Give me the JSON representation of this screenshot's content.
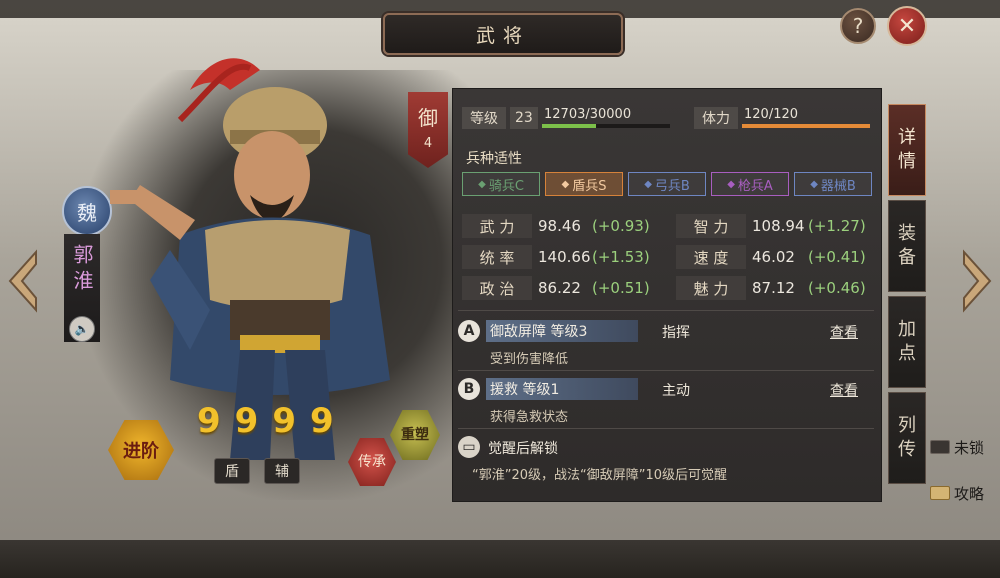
{
  "window": {
    "title": "武将"
  },
  "controls": {
    "help": "?",
    "close": "✕"
  },
  "general": {
    "faction": "魏",
    "name": "郭淮",
    "rank_char": "御",
    "rank_num": "4"
  },
  "level": {
    "label": "等级",
    "value": "23",
    "exp": "12703/30000",
    "exp_fraction": 0.4234
  },
  "stamina": {
    "label": "体力",
    "value": "120/120",
    "fraction": 1.0
  },
  "troops": {
    "title": "兵种适性",
    "items": [
      {
        "icon": "horse-icon",
        "label": "骑兵C",
        "color": "#6aa072"
      },
      {
        "icon": "shield-icon",
        "label": "盾兵S",
        "color": "#d6823a"
      },
      {
        "icon": "bow-icon",
        "label": "弓兵B",
        "color": "#6e86c2"
      },
      {
        "icon": "spear-icon",
        "label": "枪兵A",
        "color": "#a85ec0"
      },
      {
        "icon": "siege-icon",
        "label": "器械B",
        "color": "#6e86c2"
      }
    ]
  },
  "attributes": [
    {
      "label": "武 力",
      "value": "98.46",
      "bonus": "(+0.93)"
    },
    {
      "label": "智 力",
      "value": "108.94",
      "bonus": "(+1.27)"
    },
    {
      "label": "统 率",
      "value": "140.66",
      "bonus": "(+1.53)"
    },
    {
      "label": "速 度",
      "value": "46.02",
      "bonus": "(+0.41)"
    },
    {
      "label": "政 治",
      "value": "86.22",
      "bonus": "(+0.51)"
    },
    {
      "label": "魅 力",
      "value": "87.12",
      "bonus": "(+0.46)"
    }
  ],
  "skills": [
    {
      "letter": "A",
      "name": "御敌屏障 等级3",
      "type": "指挥",
      "view": "查看",
      "desc": "受到伤害降低"
    },
    {
      "letter": "B",
      "name": "援救 等级1",
      "type": "主动",
      "view": "查看",
      "desc": "获得急救状态"
    }
  ],
  "awaken": {
    "title": "觉醒后解锁",
    "desc": "“郭淮”20级，战法“御敌屏障”10级后可觉醒"
  },
  "bottom": {
    "advance": "进阶",
    "stars": [
      "9",
      "9",
      "9",
      "9"
    ],
    "role_tags": [
      "盾",
      "辅"
    ],
    "inherit": "传承",
    "reshape": "重塑"
  },
  "side_tabs": [
    {
      "label": "详情",
      "chars": [
        "详",
        "情"
      ],
      "active": true
    },
    {
      "label": "装备",
      "chars": [
        "装",
        "备"
      ],
      "active": false
    },
    {
      "label": "加点",
      "chars": [
        "加",
        "点"
      ],
      "active": false
    },
    {
      "label": "列传",
      "chars": [
        "列",
        "传"
      ],
      "active": false
    }
  ],
  "side_links": [
    {
      "label": "未锁",
      "icon": "lock-icon"
    },
    {
      "label": "攻略",
      "icon": "scroll-icon"
    }
  ]
}
